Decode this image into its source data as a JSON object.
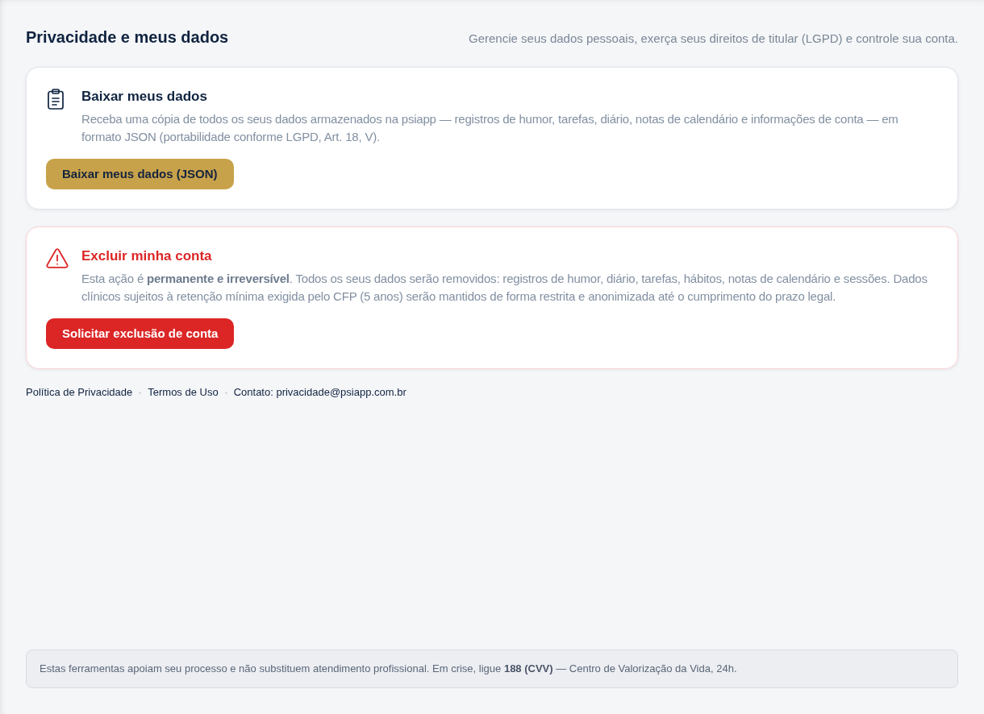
{
  "header": {
    "title": "Privacidade e meus dados",
    "subtitle": "Gerencie seus dados pessoais, exerça seus direitos de titular (LGPD) e controle sua conta."
  },
  "cards": [
    {
      "kind": "export",
      "title": "Baixar meus dados",
      "description": "Receba uma cópia de todos os seus dados armazenados na psiapp — registros de humor, tarefas, diário, notas de calendário e informações de conta — em formato JSON (portabilidade conforme LGPD, Art. 18, V).",
      "button": "Baixar meus dados (JSON)"
    },
    {
      "kind": "danger",
      "title": "Excluir minha conta",
      "description": "Esta ação é **permanente e irreversível**. Todos os seus dados serão removidos: registros de humor, diário, tarefas, hábitos, notas de calendário e sessões. Dados clínicos sujeitos à retenção mínima exigida pelo CFP (5 anos) serão mantidos de forma restrita e anonimizada até o cumprimento do prazo legal.",
      "button": "Solicitar exclusão de conta"
    }
  ],
  "footer_links": [
    "Política de Privacidade",
    "Termos de Uso",
    "Contato: privacidade@psiapp.com.br"
  ],
  "notice": "Estas ferramentas apoiam seu processo e não substituem atendimento profissional. Em crise, ligue **188 (CVV)** — Centro de Valorização da Vida, 24h."
}
